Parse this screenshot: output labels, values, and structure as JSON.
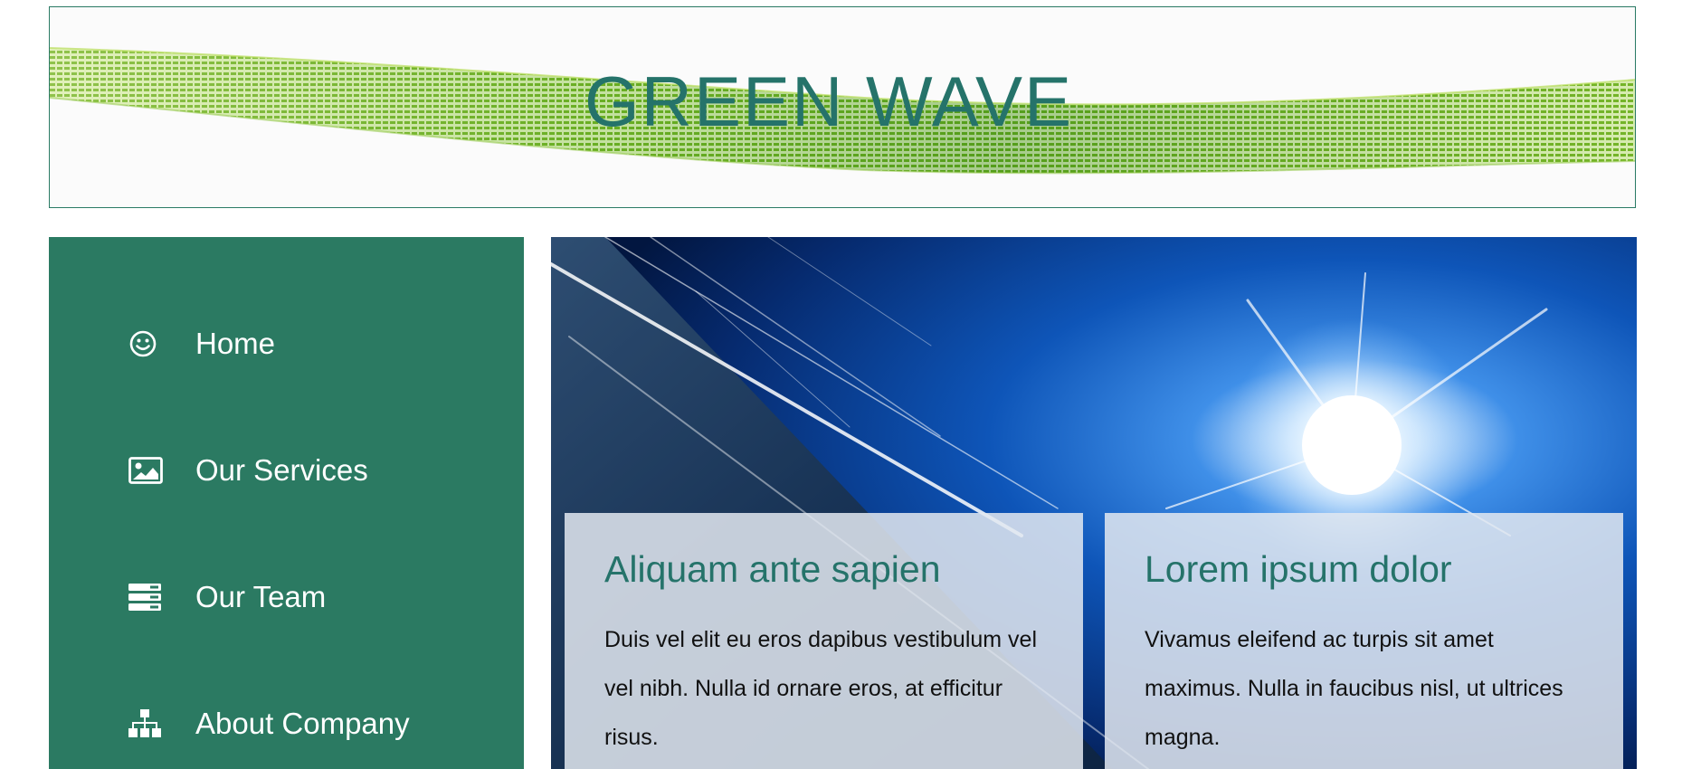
{
  "site": {
    "title": "GREEN WAVE",
    "accent_color": "#2b7a62",
    "title_color": "#25736a"
  },
  "sidebar": {
    "items": [
      {
        "label": "Home",
        "icon": "smile-icon"
      },
      {
        "label": "Our Services",
        "icon": "image-icon"
      },
      {
        "label": "Our Team",
        "icon": "server-icon"
      },
      {
        "label": "About Company",
        "icon": "sitemap-icon"
      }
    ]
  },
  "hero": {
    "cards": [
      {
        "title": "Aliquam ante sapien",
        "text": "Duis vel elit eu eros dapibus vestibulum vel vel nibh. Nulla id ornare eros, at efficitur risus."
      },
      {
        "title": "Lorem ipsum dolor",
        "text": "Vivamus eleifend ac turpis sit amet maximus. Nulla in faucibus nisl, ut ultrices magna."
      }
    ]
  }
}
